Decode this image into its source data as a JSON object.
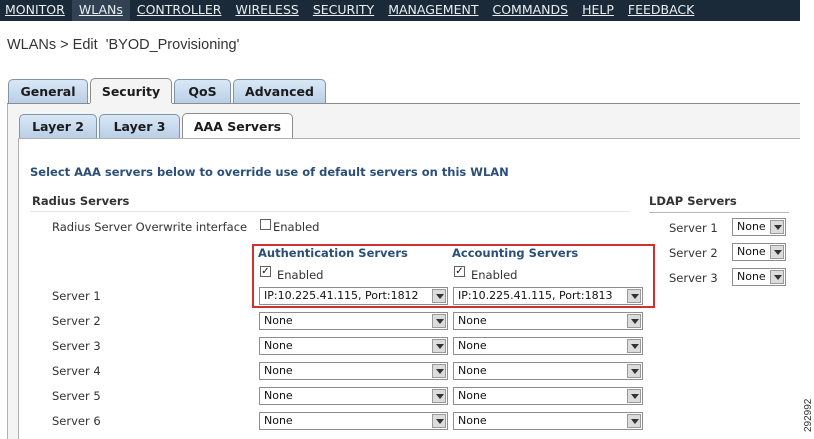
{
  "menu": [
    {
      "label": "MONITOR",
      "active": false
    },
    {
      "label": "WLANs",
      "active": true
    },
    {
      "label": "CONTROLLER",
      "active": false
    },
    {
      "label": "WIRELESS",
      "active": false
    },
    {
      "label": "SECURITY",
      "active": false
    },
    {
      "label": "MANAGEMENT",
      "active": false
    },
    {
      "label": "COMMANDS",
      "active": false
    },
    {
      "label": "HELP",
      "active": false
    },
    {
      "label": "FEEDBACK",
      "active": false
    }
  ],
  "page_title": "WLANs > Edit  'BYOD_Provisioning'",
  "tabs": [
    "General",
    "Security",
    "QoS",
    "Advanced"
  ],
  "active_tab": "Security",
  "subtabs": [
    "Layer 2",
    "Layer 3",
    "AAA Servers"
  ],
  "active_subtab": "AAA Servers",
  "instruction": "Select AAA servers below to override use of default servers on this WLAN",
  "radius": {
    "heading": "Radius Servers",
    "overwrite_label": "Radius Server Overwrite interface",
    "overwrite_checkbox_label": "Enabled",
    "overwrite_checked": false,
    "auth_heading": "Authentication Servers",
    "acct_heading": "Accounting Servers",
    "auth_enabled_label": "Enabled",
    "acct_enabled_label": "Enabled",
    "auth_enabled": true,
    "acct_enabled": true,
    "servers": [
      {
        "label": "Server 1",
        "auth": "IP:10.225.41.115, Port:1812",
        "acct": "IP:10.225.41.115, Port:1813"
      },
      {
        "label": "Server 2",
        "auth": "None",
        "acct": "None"
      },
      {
        "label": "Server 3",
        "auth": "None",
        "acct": "None"
      },
      {
        "label": "Server 4",
        "auth": "None",
        "acct": "None"
      },
      {
        "label": "Server 5",
        "auth": "None",
        "acct": "None"
      },
      {
        "label": "Server 6",
        "auth": "None",
        "acct": "None"
      }
    ]
  },
  "ldap": {
    "heading": "LDAP Servers",
    "servers": [
      {
        "label": "Server 1",
        "value": "None"
      },
      {
        "label": "Server 2",
        "value": "None"
      },
      {
        "label": "Server 3",
        "value": "None"
      }
    ]
  },
  "figure_code": "292992",
  "colors": {
    "menubar": "#1b2a38",
    "highlight": "#d3312f",
    "tab": "#c7dbee"
  }
}
